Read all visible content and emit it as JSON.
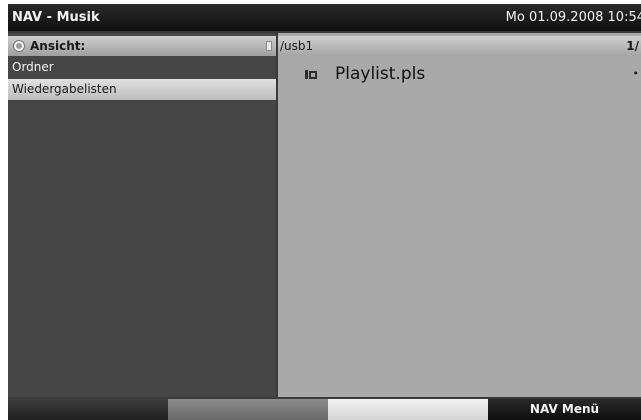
{
  "titlebar": {
    "title": "NAV - Musik",
    "datetime": "Mo 01.09.2008  10:54"
  },
  "left_pane": {
    "header_label": "Ansicht:",
    "items": [
      {
        "label": "Ordner",
        "selected": false
      },
      {
        "label": "Wiedergabelisten",
        "selected": true
      }
    ]
  },
  "right_pane": {
    "path": "/usb1",
    "page": "1/",
    "files": [
      {
        "name": "Playlist.pls",
        "icon": "playlist-icon",
        "marker": "•"
      }
    ]
  },
  "bottom_bar": {
    "keys": [
      {
        "color": "red",
        "label": ""
      },
      {
        "color": "green",
        "label": ""
      },
      {
        "color": "yellow",
        "label": ""
      },
      {
        "color": "blue",
        "label": "NAV Menü"
      }
    ]
  }
}
